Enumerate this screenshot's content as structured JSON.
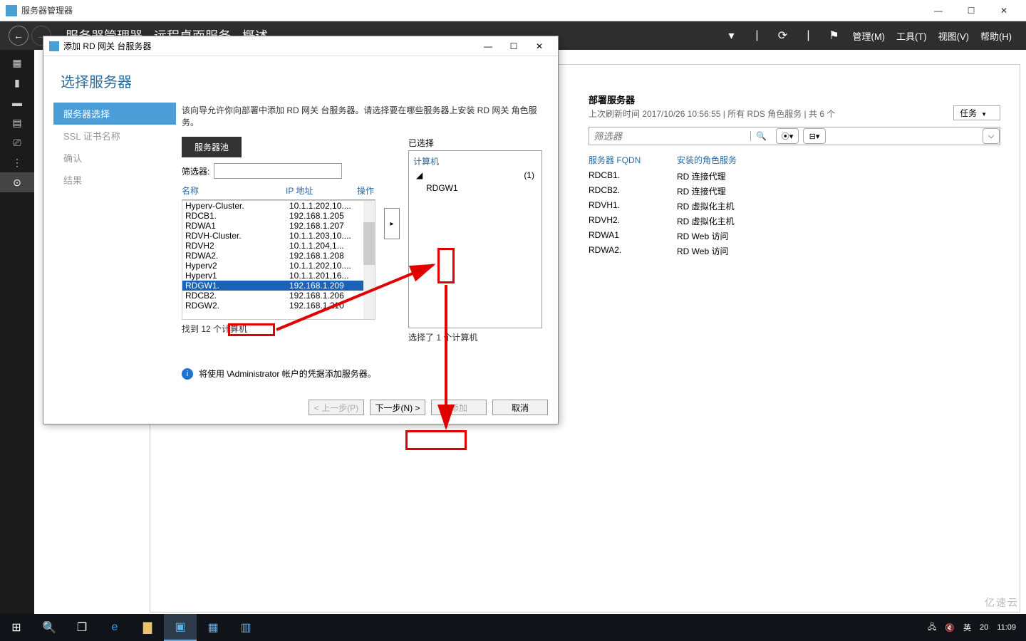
{
  "window": {
    "title": "服务器管理器",
    "min": "—",
    "max": "☐",
    "close": "✕"
  },
  "header": {
    "back": "←",
    "fwd": "→",
    "crumb": "服务器管理器 · 远程桌面服务 · 概述",
    "refresh": "⟳",
    "flag": "⚑",
    "menus": [
      "管理(M)",
      "工具(T)",
      "视图(V)",
      "帮助(H)"
    ]
  },
  "rail": {
    "items": [
      "▦",
      "▮",
      "▬",
      "▤",
      "⎚",
      "⋮",
      "⊙"
    ],
    "selected_index": 6
  },
  "modal": {
    "title": "添加 RD 网关 台服务器",
    "heading": "选择服务器",
    "steps": [
      "服务器选择",
      "SSL 证书名称",
      "确认",
      "结果"
    ],
    "desc": "该向导允许你向部署中添加 RD 网关 台服务器。请选择要在哪些服务器上安装 RD 网关 角色服务。",
    "tab": "服务器池",
    "filter_label": "筛选器:",
    "col_name": "名称",
    "col_ip": "IP 地址",
    "col_op": "操作",
    "pool": [
      {
        "name": "Hyperv-Cluster.",
        "ip": "10.1.1.202,10...."
      },
      {
        "name": "RDCB1.",
        "ip": "192.168.1.205"
      },
      {
        "name": "RDWA1",
        "ip": "192.168.1.207"
      },
      {
        "name": "RDVH-Cluster.",
        "ip": "10.1.1.203,10...."
      },
      {
        "name": "RDVH2",
        "ip": "10.1.1.204,1..."
      },
      {
        "name": "RDWA2.",
        "ip": "192.168.1.208"
      },
      {
        "name": "Hyperv2",
        "ip": "10.1.1.202,10...."
      },
      {
        "name": "Hyperv1",
        "ip": "10.1.1.201,16..."
      },
      {
        "name": "RDGW1.",
        "ip": "192.168.1.209",
        "selected": true
      },
      {
        "name": "RDCB2.",
        "ip": "192.168.1.206"
      },
      {
        "name": "RDGW2.",
        "ip": "192.168.1.210"
      }
    ],
    "found": "找到 12 个计算机",
    "add_arrow": "▸",
    "selected_label": "已选择",
    "selected_header": "计算机",
    "selected_count": "(1)",
    "selected_item": "RDGW1",
    "selected_footer": "选择了 1 个计算机",
    "credential": "将使用          \\Administrator 帐户的凭据添加服务器。",
    "buttons": {
      "prev": "< 上一步(P)",
      "next": "下一步(N) >",
      "add": "添加",
      "cancel": "取消"
    }
  },
  "rightpanel": {
    "title": "部署服务器",
    "sub": "上次刷新时间 2017/10/26 10:56:55 | 所有 RDS 角色服务 | 共 6 个",
    "task": "任务",
    "filter_placeholder": "筛选器",
    "th1": "服务器 FQDN",
    "th2": "安装的角色服务",
    "rows": [
      {
        "f": "RDCB1.",
        "r": "RD 连接代理"
      },
      {
        "f": "RDCB2.",
        "r": "RD 连接代理"
      },
      {
        "f": "RDVH1.",
        "r": "RD 虚拟化主机"
      },
      {
        "f": "RDVH2.",
        "r": "RD 虚拟化主机"
      },
      {
        "f": "RDWA1",
        "r": "RD Web 访问"
      },
      {
        "f": "RDWA2.",
        "r": "RD Web 访问"
      }
    ]
  },
  "taskbar": {
    "time": "11:09",
    "date": "20",
    "ime": "英",
    "watermark": "亿速云"
  }
}
